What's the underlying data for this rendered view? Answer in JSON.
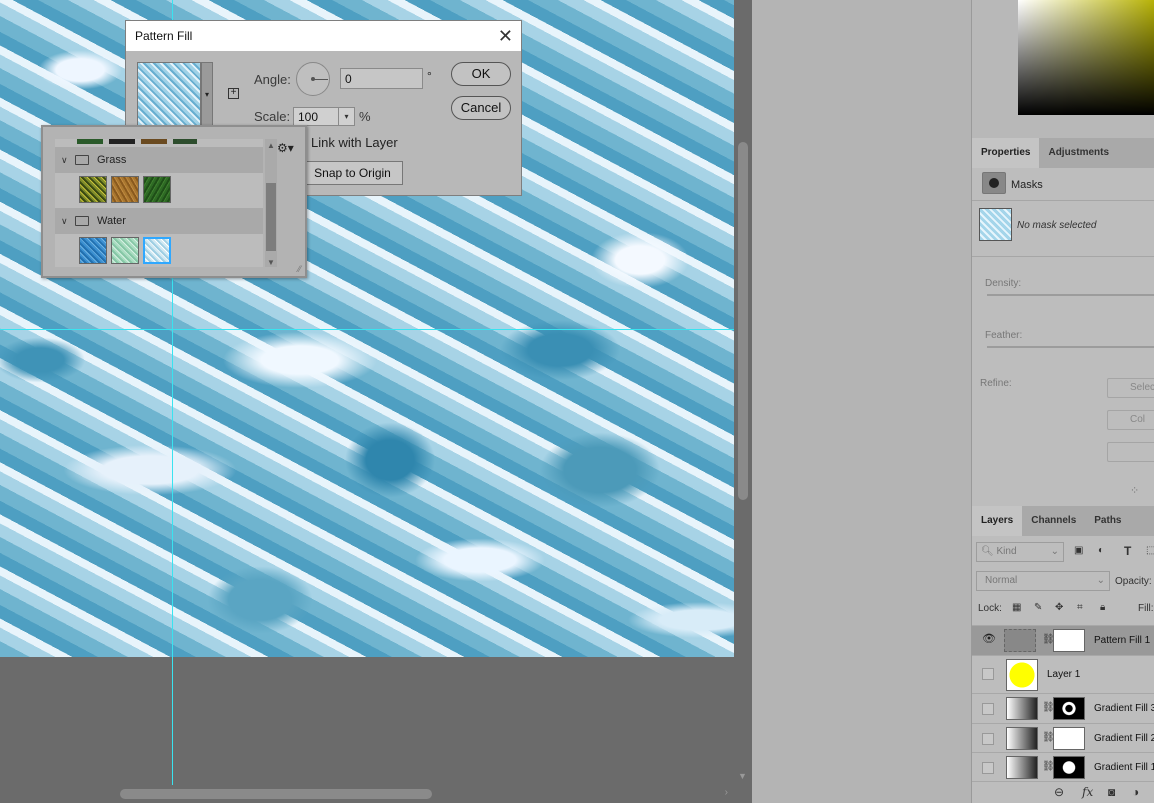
{
  "dialog": {
    "title": "Pattern Fill",
    "angle_label": "Angle:",
    "angle_value": "0",
    "degree_symbol": "°",
    "scale_label": "Scale:",
    "scale_value": "100",
    "percent_symbol": "%",
    "link_label": "Link with Layer",
    "snap_label": "Snap to Origin",
    "ok_label": "OK",
    "cancel_label": "Cancel",
    "close_glyph": "✕"
  },
  "picker": {
    "groups": [
      {
        "name": "Grass",
        "swatch_colors": [
          "#7c8a2a",
          "#a9772f",
          "#2e6a24"
        ]
      },
      {
        "name": "Water",
        "swatch_colors": [
          "#3b8fd0",
          "#a8dcc0",
          "#cfe8f2"
        ]
      }
    ],
    "selected_swatch": "Water-3"
  },
  "properties": {
    "tabs": [
      "Properties",
      "Adjustments"
    ],
    "active_tab": "Properties",
    "section": "Masks",
    "no_mask_text": "No mask selected",
    "density_label": "Density:",
    "feather_label": "Feather:",
    "refine_label": "Refine:",
    "refine_buttons": [
      "Select",
      "Col",
      ""
    ]
  },
  "layers": {
    "tabs": [
      "Layers",
      "Channels",
      "Paths"
    ],
    "active_tab": "Layers",
    "kind_label": "Kind",
    "blend_mode": "Normal",
    "opacity_label": "Opacity:",
    "lock_label": "Lock:",
    "fill_label": "Fill:",
    "items": [
      {
        "name": "Pattern Fill 1",
        "visible": true,
        "selected": true
      },
      {
        "name": "Layer 1",
        "visible": false,
        "selected": false
      },
      {
        "name": "Gradient Fill 3",
        "visible": false,
        "selected": false
      },
      {
        "name": "Gradient Fill 2",
        "visible": false,
        "selected": false
      },
      {
        "name": "Gradient Fill 1",
        "visible": false,
        "selected": false
      }
    ]
  },
  "colors": {
    "guide": "#39e3f0",
    "layer1_fill": "#ffff00",
    "selected_swatch_border": "#2fa8ff"
  }
}
